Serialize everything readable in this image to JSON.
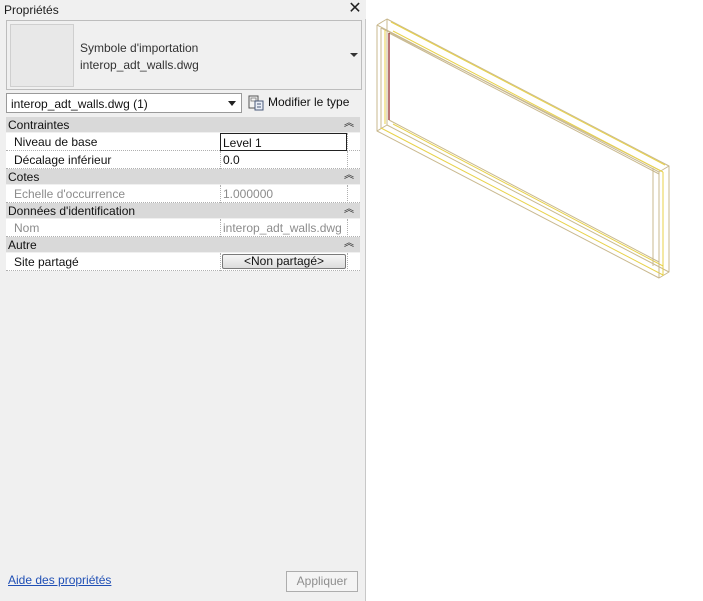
{
  "palette": {
    "title": "Propriétés",
    "type_selector": {
      "family": "Symbole d'importation",
      "type": "interop_adt_walls.dwg"
    },
    "instance_filter": {
      "value": "interop_adt_walls.dwg (1)"
    },
    "edit_type_label": "Modifier le type",
    "sections": [
      {
        "name": "Contraintes",
        "rows": [
          {
            "label": "Niveau de base",
            "value": "Level 1"
          },
          {
            "label": "Décalage inférieur",
            "value": "0.0"
          }
        ]
      },
      {
        "name": "Cotes",
        "rows": [
          {
            "label": "Echelle d'occurrence",
            "value": "1.000000"
          }
        ]
      },
      {
        "name": "Données d'identification",
        "rows": [
          {
            "label": "Nom",
            "value": "interop_adt_walls.dwg"
          }
        ]
      },
      {
        "name": "Autre",
        "rows": [
          {
            "label": "Site partagé",
            "value": "<Non partagé>"
          }
        ]
      }
    ],
    "help_link": "Aide des propriétés",
    "apply_label": "Appliquer",
    "collapse_icon": "double-chevron-up-icon",
    "close_icon": "close-icon"
  },
  "colors": {
    "panel_bg": "#f0f0f0",
    "section_bg": "#d9d9d9",
    "link": "#1f4fb5",
    "wall_edge": "#c9b98f",
    "wall_highlight": "#e8d24a",
    "wall_dark": "#8b1a1a"
  }
}
